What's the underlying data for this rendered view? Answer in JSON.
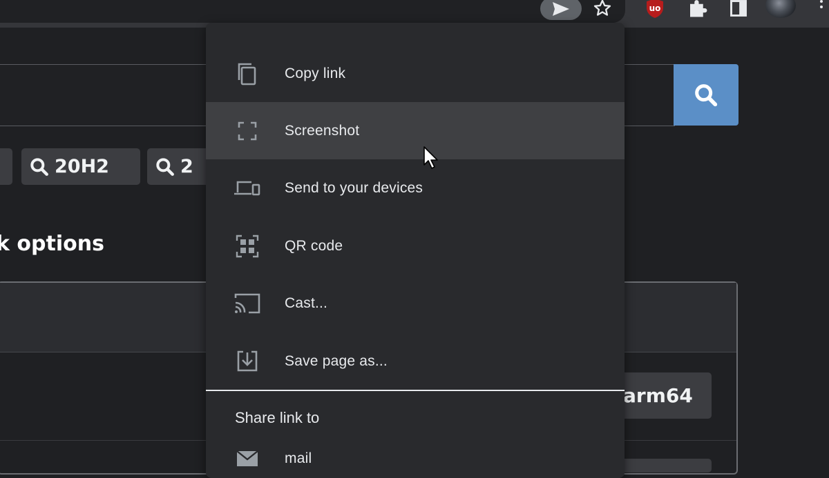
{
  "toolbar": {
    "icons": [
      "send-tab-icon",
      "bookmark-star-icon",
      "ublock-extension-icon",
      "extensions-puzzle-icon",
      "side-panel-icon",
      "profile-avatar",
      "more-menu-icon"
    ],
    "ublock_badge_color": "#b71c1c"
  },
  "page": {
    "search_button_color": "#5b8fc7",
    "chips": [
      {
        "label": ""
      },
      {
        "label": "20H2"
      },
      {
        "label": "2"
      }
    ],
    "heading": "k options",
    "arm_button_label": "arm64"
  },
  "share_menu": {
    "items": [
      {
        "label": "Copy link",
        "icon": "copy-icon"
      },
      {
        "label": "Screenshot",
        "icon": "screenshot-icon",
        "hovered": true
      },
      {
        "label": "Send to your devices",
        "icon": "devices-icon"
      },
      {
        "label": "QR code",
        "icon": "qr-code-icon"
      },
      {
        "label": "Cast...",
        "icon": "cast-icon"
      },
      {
        "label": "Save page as...",
        "icon": "save-page-icon"
      }
    ],
    "share_section_title": "Share link to",
    "share_targets": [
      {
        "label": "mail",
        "icon": "mail-icon"
      }
    ]
  }
}
